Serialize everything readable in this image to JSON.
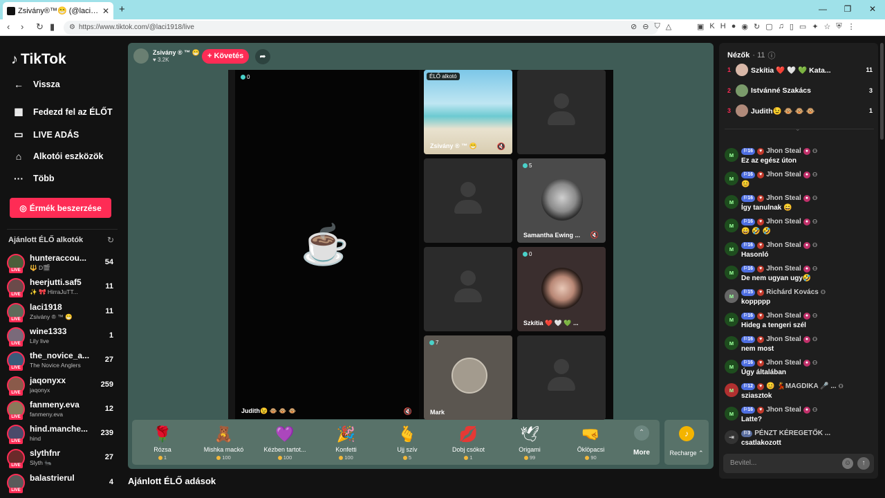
{
  "browser": {
    "tab_title": "Zsivány®™😁 (@laci1913) É...",
    "url": "https://www.tiktok.com/@laci1918/live"
  },
  "sidebar": {
    "logo": "TikTok",
    "back": "Vissza",
    "nav": [
      "Fedezd fel az ÉLŐT",
      "LIVE ADÁS",
      "Alkotói eszközök",
      "Több"
    ],
    "coin_button": "Érmék beszerzése",
    "recommended_title": "Ajánlott ÉLŐ alkotók",
    "creators": [
      {
        "name": "hunteraccou...",
        "sub": "🔱 D🎬",
        "count": "54"
      },
      {
        "name": "heerjutti.saf5",
        "sub": "✨ 🎀 HirraJuTT...",
        "count": "11"
      },
      {
        "name": "laci1918",
        "sub": "Zsivány ® ™ 😁",
        "count": "11"
      },
      {
        "name": "wine1333",
        "sub": "Lily live",
        "count": "1"
      },
      {
        "name": "the_novice_a...",
        "sub": "The Novice Anglers",
        "count": "27"
      },
      {
        "name": "jaqonyxx",
        "sub": "jaqonyx",
        "count": "259"
      },
      {
        "name": "fanmeny.eva",
        "sub": "fanmeny.eva",
        "count": "12"
      },
      {
        "name": "hind.manche...",
        "sub": "hind",
        "count": "239"
      },
      {
        "name": "slythfnr",
        "sub": "Slyth 🐜",
        "count": "27"
      },
      {
        "name": "balastrierul",
        "sub": "",
        "count": "4"
      }
    ],
    "live_badge": "LIVE"
  },
  "host": {
    "name": "Zsivány ® ™ 😁",
    "likes": "♥ 3.2K",
    "follow": "+ Követés"
  },
  "video": {
    "main_count": "0",
    "main_label": "Judith😉 🐵 🐵 🐵",
    "host_tile": {
      "tag": "ÉLŐ alkotó",
      "label": "Zsivány ® ™ 😁"
    },
    "samantha": {
      "count": "5",
      "label": "Samantha Ewing ..."
    },
    "szkitia": {
      "count": "0",
      "label": "Szkítia ❤️ 🤍 💚 ..."
    },
    "mark": {
      "count": "7",
      "label": "Mark"
    }
  },
  "gifts": [
    {
      "icon": "🌹",
      "name": "Rózsa",
      "price": "1"
    },
    {
      "icon": "🧸",
      "name": "Mishka mackó",
      "price": "100"
    },
    {
      "icon": "💜",
      "name": "Kézben tartot...",
      "price": "100"
    },
    {
      "icon": "🎉",
      "name": "Konfetti",
      "price": "100"
    },
    {
      "icon": "🫰",
      "name": "Ujj szív",
      "price": "5"
    },
    {
      "icon": "💋",
      "name": "Dobj csókot",
      "price": "1"
    },
    {
      "icon": "🕊",
      "name": "Origami",
      "price": "99"
    },
    {
      "icon": "🤜",
      "name": "Öklöpacsi",
      "price": "90"
    }
  ],
  "more_label": "More",
  "recharge_label": "Recharge",
  "recommended_lives": "Ajánlott ÉLŐ adások",
  "viewers": {
    "title": "Nézők",
    "count": "· 11",
    "top": [
      {
        "rank": "1",
        "name": "Szkítia ❤️ 🤍 💚 Kata...",
        "score": "11",
        "color": "#d9b8a8"
      },
      {
        "rank": "2",
        "name": "Istvánné Szakács",
        "score": "3",
        "color": "#7a9a6a"
      },
      {
        "rank": "3",
        "name": "Judith😉 🐵 🐵 🐵",
        "score": "1",
        "color": "#b08a7a"
      }
    ]
  },
  "chat": [
    {
      "user": "Jhon Steal",
      "lvl": "16",
      "text": "Ez az egész úton"
    },
    {
      "user": "Jhon Steal",
      "lvl": "16",
      "text": "😊"
    },
    {
      "user": "Jhon Steal",
      "lvl": "16",
      "text": "Így tanulnak 😄"
    },
    {
      "user": "Jhon Steal",
      "lvl": "16",
      "text": "😄 🤣 🤣"
    },
    {
      "user": "Jhon Steal",
      "lvl": "16",
      "text": "Hasonló"
    },
    {
      "user": "Jhon Steal",
      "lvl": "16",
      "text": "De nem ugyan ugy🤣"
    },
    {
      "user": "Richárd Kovács",
      "lvl": "15",
      "text": "koppppp"
    },
    {
      "user": "Jhon Steal",
      "lvl": "16",
      "text": "Hideg a tengeri szél"
    },
    {
      "user": "Jhon Steal",
      "lvl": "16",
      "text": "nem most"
    },
    {
      "user": "Jhon Steal",
      "lvl": "16",
      "text": "Úgy általában"
    },
    {
      "user": "😊 💃MAGDIKA 🎤 ...",
      "lvl": "12",
      "text": "sziasztok"
    },
    {
      "user": "Jhon Steal",
      "lvl": "16",
      "text": "Latte?"
    }
  ],
  "join": {
    "lvl": "3",
    "name": "PÉNZT KÉREGETŐK ...",
    "text": "csatlakozott"
  },
  "input_placeholder": "Bevitel..."
}
